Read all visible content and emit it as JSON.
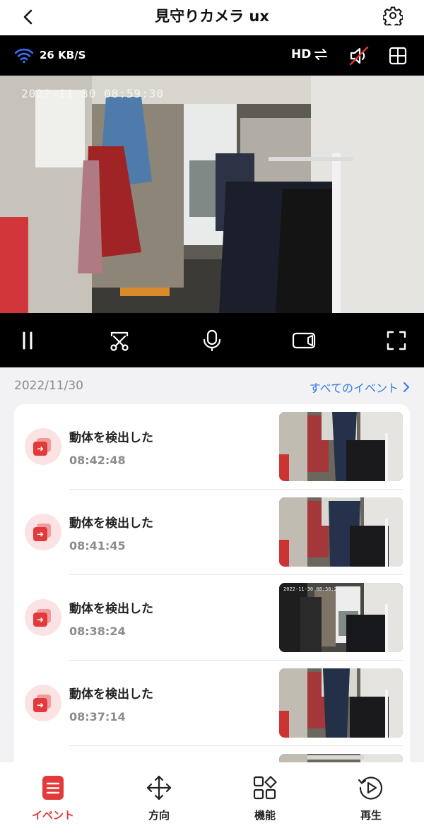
{
  "header": {
    "title": "見守りカメラ ux"
  },
  "video": {
    "network_speed": "26 KB/S",
    "quality_label": "HD",
    "timestamp": "2022-11-30 08:59:30"
  },
  "events_section": {
    "date": "2022/11/30",
    "all_events_label": "すべてのイベント"
  },
  "events": [
    {
      "title": "動体を検出した",
      "time": "08:42:48"
    },
    {
      "title": "動体を検出した",
      "time": "08:41:45"
    },
    {
      "title": "動体を検出した",
      "time": "08:38:24",
      "thumb_timestamp": "2022-11-30 08:38:24"
    },
    {
      "title": "動体を検出した",
      "time": "08:37:14"
    }
  ],
  "nav": {
    "items": [
      {
        "label": "イベント",
        "active": true
      },
      {
        "label": "方向"
      },
      {
        "label": "機能"
      },
      {
        "label": "再生"
      }
    ]
  },
  "colors": {
    "accent": "#e23a3a",
    "link": "#2f7be8",
    "wifi": "#3b6df0"
  }
}
